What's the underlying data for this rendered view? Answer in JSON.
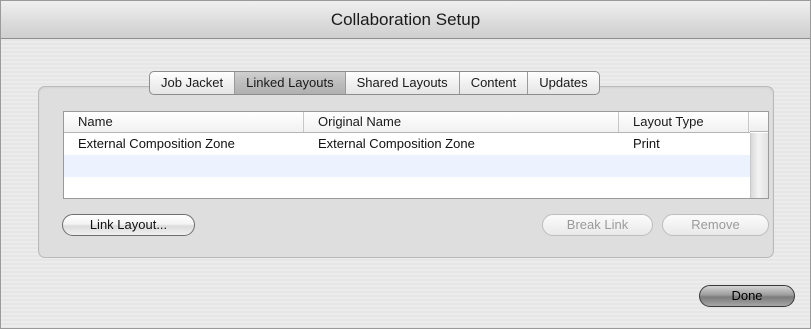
{
  "window": {
    "title": "Collaboration Setup"
  },
  "tabs": [
    {
      "label": "Job Jacket",
      "selected": false
    },
    {
      "label": "Linked Layouts",
      "selected": true
    },
    {
      "label": "Shared Layouts",
      "selected": false
    },
    {
      "label": "Content",
      "selected": false
    },
    {
      "label": "Updates",
      "selected": false
    }
  ],
  "table": {
    "columns": [
      "Name",
      "Original Name",
      "Layout Type"
    ],
    "rows": [
      [
        "External Composition Zone",
        "External Composition Zone",
        "Print"
      ]
    ]
  },
  "buttons": {
    "link_layout": "Link Layout...",
    "break_link": "Break Link",
    "remove": "Remove",
    "done": "Done"
  },
  "colors": {
    "selected_tab": "#bdbdbd",
    "row_alternate": "#edf3fe",
    "default_button": "#9c9c9c"
  }
}
